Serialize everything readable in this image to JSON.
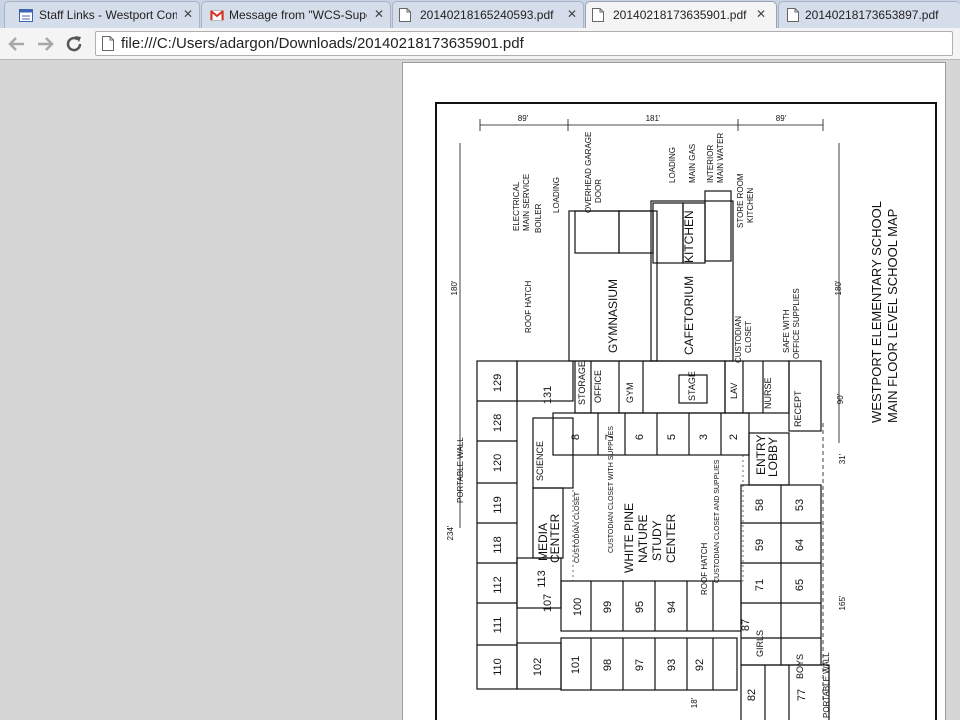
{
  "tabs": [
    {
      "title": "Staff Links - Westport Com",
      "icon": "document-icon",
      "active": false
    },
    {
      "title": "Message from \"WCS-Supe",
      "icon": "gmail-icon",
      "active": false
    },
    {
      "title": "20140218165240593.pdf",
      "icon": "pdf-page-icon",
      "active": false
    },
    {
      "title": "20140218173635901.pdf",
      "icon": "pdf-page-icon",
      "active": true
    },
    {
      "title": "20140218173653897.pdf",
      "icon": "pdf-page-icon",
      "active": false
    }
  ],
  "toolbar": {
    "url": "file:///C:/Users/adargon/Downloads/20140218173635901.pdf"
  },
  "map": {
    "title_line1": "WESTPORT ELEMENTARY SCHOOL",
    "title_line2": "MAIN FLOOR LEVEL SCHOOL MAP",
    "dim_top_1": "89'",
    "dim_top_2": "181'",
    "dim_top_3": "89'",
    "dim_side_left": "180'",
    "dim_side_right": "180'",
    "dim_234": "234'",
    "dim_90": "90'",
    "dim_31": "31'",
    "dim_165": "165'",
    "dim_18": "18'",
    "labels": {
      "electrical": "ELECTRICAL",
      "main_service": "MAIN SERVICE",
      "boiler": "BOILER",
      "loading1": "LOADING",
      "garage1": "OVERHEAD GARAGE",
      "garage2": "DOOR",
      "loading2": "LOADING",
      "main_gas": "MAIN GAS",
      "interior": "INTERIOR",
      "main_water": "MAIN WATER",
      "store_room": "STORE ROOM",
      "kitchen_label": "KITCHEN",
      "gymnasium": "GYMNASIUM",
      "cafetorium": "CAFETORIUM",
      "kitchen": "KITCHEN",
      "stage": "STAGE",
      "custodian1": "CUSTODIAN",
      "closet1": "CLOSET",
      "safe": "SAFE WITH",
      "office_supplies": "OFFICE SUPPLIES",
      "roof_hatch1": "ROOF HATCH",
      "roof_hatch2": "ROOF HATCH",
      "portable_wall1": "PORTABLE WALL",
      "portable_wall2": "PORTABLE WALL",
      "office": "OFFICE",
      "storage": "STORAGE",
      "gym": "GYM",
      "lav": "LAV",
      "nurse": "NURSE",
      "entry": "ENTRY",
      "lobby": "LOBBY",
      "media": "MEDIA",
      "center": "CENTER",
      "white_pine": "WHITE PINE",
      "nature": "NATURE",
      "study": "STUDY",
      "study_center": "CENTER",
      "science": "SCIENCE",
      "cust_math": "CUSTODIAN CLOSET WITH SUPPLIES",
      "cust_closet": "CUSTODIAN CLOSET",
      "cust_supplies": "CUSTODIAN CLOSET AND SUPPLIES",
      "reception": "RECEPT",
      "boys": "BOYS",
      "girls": "GIRLS"
    },
    "rooms_left": [
      "129",
      "128",
      "120",
      "119",
      "118",
      "112",
      "111",
      "110"
    ],
    "rooms_inner_left": [
      "131",
      "113",
      "107",
      "102"
    ],
    "rooms_top": [
      "8",
      "7",
      "6",
      "5",
      "3",
      "2"
    ],
    "rooms_bottom_upper": [
      "100",
      "99",
      "95",
      "94"
    ],
    "rooms_bottom_lower": [
      "101",
      "98",
      "97",
      "93",
      "92"
    ],
    "rooms_right": [
      "58",
      "53",
      "59",
      "64",
      "71",
      "65",
      "87",
      "82",
      "77"
    ]
  }
}
